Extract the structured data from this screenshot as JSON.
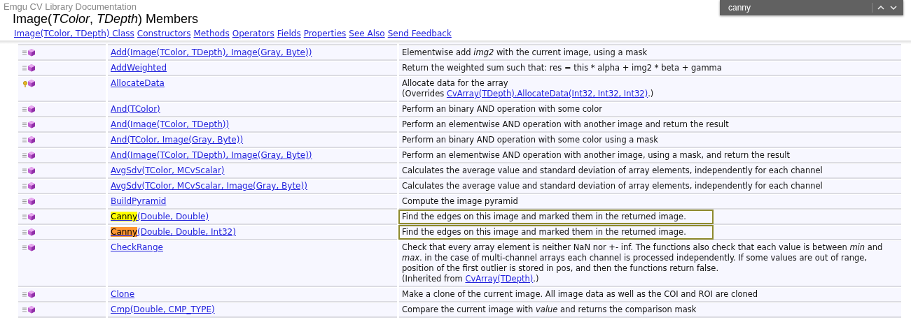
{
  "header": {
    "library": "Emgu CV Library Documentation",
    "title": "Image(*TColor*, *TDepth*) Members",
    "nav": [
      "Image(TColor, TDepth) Class",
      "Constructors",
      "Methods",
      "Operators",
      "Fields",
      "Properties",
      "See Also",
      "Send Feedback"
    ]
  },
  "find_bar": {
    "value": "canny"
  },
  "members": [
    {
      "kind": "public",
      "name": "Add(Image(TColor, TDepth), Image(Gray, Byte))",
      "description": "Elementwise add *img2* with the current image, using a mask",
      "outlined": false
    },
    {
      "kind": "public",
      "name": "AddWeighted",
      "description": "Return the weighted sum such that: res = this * alpha + img2 * beta + gamma",
      "outlined": false
    },
    {
      "kind": "protected",
      "name": "AllocateData",
      "description": "Allocate data for the array",
      "note": {
        "prefix": "(Overrides ",
        "link": "CvArray(TDepth).AllocateData(Int32, Int32, Int32)",
        "suffix": ".)"
      },
      "outlined": false
    },
    {
      "kind": "public",
      "name": "And(TColor)",
      "description": "Perform an binary AND operation with some color",
      "outlined": false
    },
    {
      "kind": "public",
      "name": "And(Image(TColor, TDepth))",
      "description": "Perform an elementwise AND operation with another image and return the result",
      "outlined": false
    },
    {
      "kind": "public",
      "name": "And(TColor, Image(Gray, Byte))",
      "description": "Perform an binary AND operation with some color using a mask",
      "outlined": false
    },
    {
      "kind": "public",
      "name": "And(Image(TColor, TDepth), Image(Gray, Byte))",
      "description": "Perform an elementwise AND operation with another image, using a mask, and return the result",
      "outlined": false
    },
    {
      "kind": "public",
      "name": "AvgSdv(TColor, MCvScalar)",
      "description": "Calculates the average value and standard deviation of array elements, independently for each channel",
      "outlined": false
    },
    {
      "kind": "public",
      "name": "AvgSdv(TColor, MCvScalar, Image(Gray, Byte))",
      "description": "Calculates the average value and standard deviation of array elements, independently for each channel",
      "outlined": false
    },
    {
      "kind": "public",
      "name": "BuildPyramid",
      "description": "Compute the image pyramid",
      "outlined": false
    },
    {
      "kind": "public",
      "match": {
        "text": "Canny",
        "current": false
      },
      "name": "(Double, Double)",
      "description": "Find the edges on this image and marked them in the returned image.",
      "outlined": true
    },
    {
      "kind": "public",
      "match": {
        "text": "Canny",
        "current": true
      },
      "name": "(Double, Double, Int32)",
      "description": "Find the edges on this image and marked them in the returned image.",
      "outlined": true
    },
    {
      "kind": "public",
      "name": "CheckRange",
      "description": "Check that every array element is neither NaN nor +- inf. The functions also check that each value is between *min* and *max*. in the case of multi-channel arrays each channel is processed independently. If some values are out of range, position of the first outlier is stored in pos, and then the functions return false.",
      "note": {
        "prefix": "(Inherited from ",
        "link": "CvArray(TDepth)",
        "suffix": ".)"
      },
      "outlined": false
    },
    {
      "kind": "public",
      "name": "Clone",
      "description": "Make a clone of the current image. All image data as well as the COI and ROI are cloned",
      "outlined": false
    },
    {
      "kind": "public",
      "name": "Cmp(Double, CMP_TYPE)",
      "description": "Compare the current image with *value* and returns the comparison mask",
      "outlined": false
    }
  ]
}
